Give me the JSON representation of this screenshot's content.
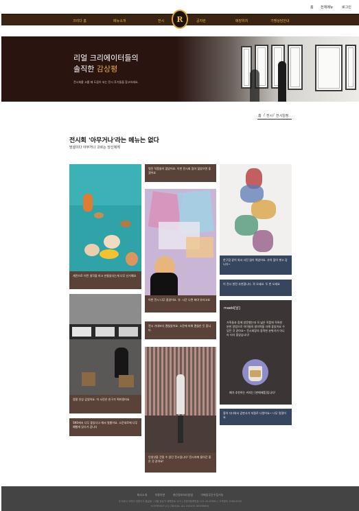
{
  "utility_nav": {
    "home": "홈",
    "sitemap": "전체메뉴",
    "login": "로그인"
  },
  "main_nav": {
    "items": [
      "크리다 홈",
      "메뉴소개",
      "전시",
      "공지란",
      "매장위치",
      "가맹상담안내"
    ]
  },
  "logo": {
    "glyph": "R"
  },
  "hero": {
    "title_line1": "리얼 크리에이터들의",
    "title_line2_plain": "솔직한 ",
    "title_line2_em": "감상평",
    "description": "전시회를 고를 때 도움이 되는 전시 후기들을 참고하세요."
  },
  "breadcrumb": {
    "home": "홈",
    "sep1": "/",
    "exhibit": "전시",
    "sep2": "/",
    "current": "전시일정"
  },
  "page": {
    "title": "전시회 '아무거나'라는 메뉴는 없다",
    "subtitle": "망설이다 아무거나 고르는 당신에게"
  },
  "reviews": {
    "col1_card1": "계란으로 이런 생각을 하고 만들었다는게 너무 신기해요",
    "col1_card2": "정말 인상 깊었어요. 이 사진은 친구가 찍어줬어요",
    "col1_card3": "SNS에서 너무 좋았다고 해서 왔봤어요. 소문대로에 너무 예뻤게 있다가 갑니다",
    "col2_card1": "멋진 작품들이 많았어요. 이번 전시회 많이 많았으면 좋겠어요",
    "col2_card2": "이번 전시 너무 좋았어요. 유. 시간 나면 봐야 유러고요",
    "col2_card3": "전시 기대보다 괜찮았어요. 소문에 비해 괜찮은 듯 합니다.",
    "col2_card4": "인생샷을 건질 수 있던 전시입니다! 전시속에 들어간 좋은 것 같아요!",
    "col3_card1": "한구합 같이 와서 사진 많이 찍었어요. 추억 많이 쌓고 갑니다~",
    "col3_card2": "이 전시 완전 추천합니다. 꼭 오세요. 두 번 오세요",
    "col3_card3": "좋아 다녀와서 갑판사가 저절로 나왔어요~ 너무 멋졌어요"
  },
  "promo": {
    "title": "maekl[남]",
    "text": "가족들과 함께 방문했는데 꼭 넓은 작품에 독특한 분한 방법으로 아이들의 창의력을 더해 좋았어요 수 있던 것 같아요~ 전시회장의 굉적한 분위기가 아니라 더더 좋았습니다!",
    "caption": "폐가 추천하는 커피는 [판매제품]입니다!"
  },
  "footer": {
    "links": [
      "회사소개",
      "이용약관",
      "개인정보처리방침",
      "이메일무단수집거부"
    ],
    "address": "주식회사 크리다 대표이사 홍길동 | 서울 강남구 테헤란로 123 | 사업자등록번호 123-45-67890 | 고객센터 1588-0000",
    "copyright": "COPYRIGHT (C) CREEDA. ALL RIGHTS RESERVED."
  },
  "colors": {
    "nav_bg": "#3a2413",
    "nav_text": "#e8b84a",
    "hero_bg": "#2a1410",
    "hero_accent": "#e4a94c",
    "caption_brown": "#5a4238",
    "caption_navy": "#35465e",
    "footer_bg": "#444444"
  }
}
